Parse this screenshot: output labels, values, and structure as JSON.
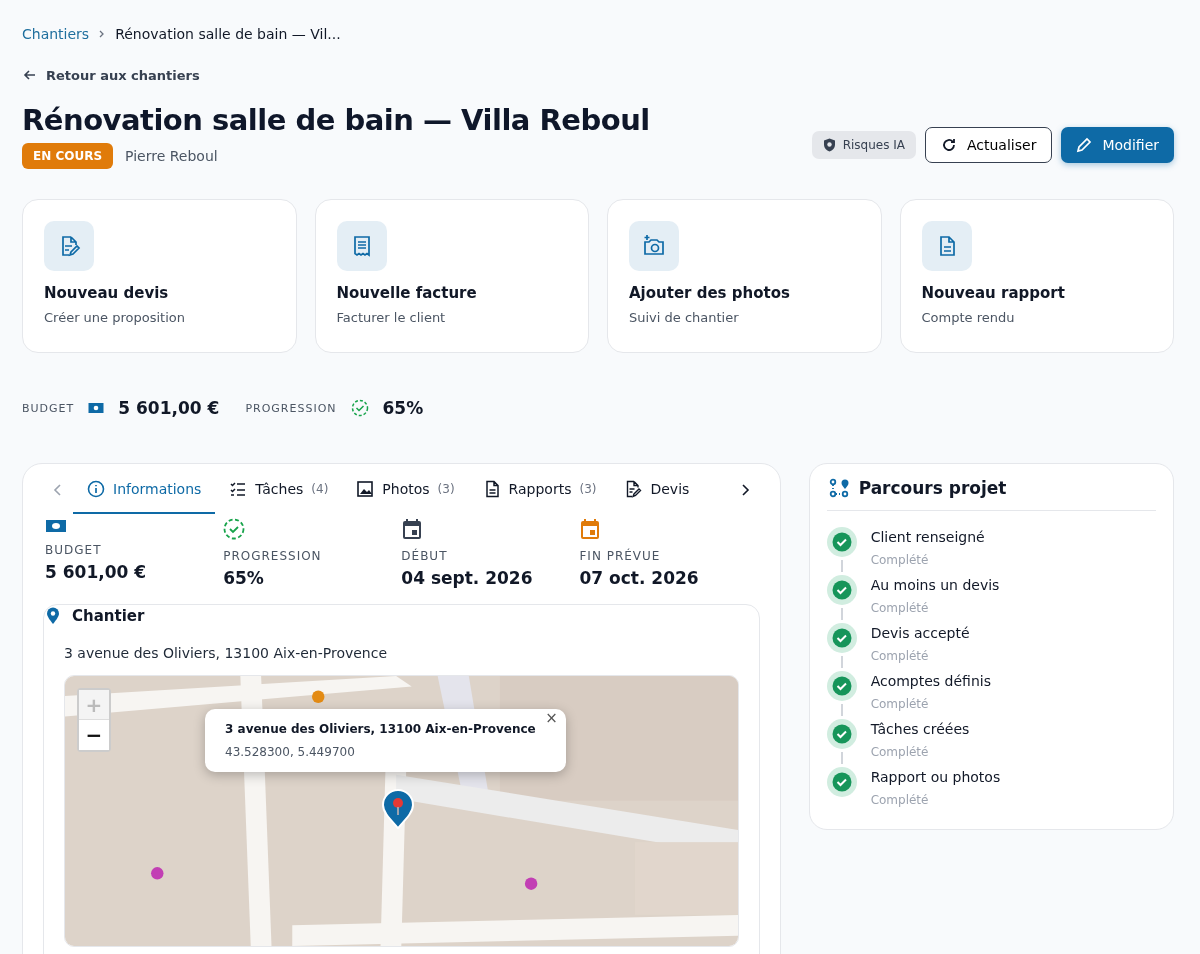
{
  "breadcrumb": {
    "link": "Chantiers",
    "current": "Rénovation salle de bain — Vil..."
  },
  "back_link": "Retour aux chantiers",
  "title": "Rénovation salle de bain — Villa Reboul",
  "status": {
    "label": "EN COURS",
    "color": "#e07b0a"
  },
  "client": "Pierre Reboul",
  "actions": [
    {
      "label": "Risques IA",
      "kind": "chip"
    },
    {
      "label": "Actualiser",
      "kind": "outline"
    },
    {
      "label": "Modifier",
      "kind": "primary"
    }
  ],
  "quick_actions": [
    {
      "title": "Nouveau devis",
      "subtitle": "Créer une proposition",
      "kind": "quote"
    },
    {
      "title": "Nouvelle facture",
      "subtitle": "Facturer le client",
      "kind": "invoice"
    },
    {
      "title": "Ajouter des photos",
      "subtitle": "Suivi de chantier"
    },
    {
      "title": "Nouveau rapport",
      "subtitle": "Compte rendu",
      "kind": "report"
    }
  ],
  "summary": [
    {
      "label": "BUDGET",
      "value": "5 601,00 €",
      "kind": "money"
    },
    {
      "label": "PROGRESSION",
      "value": "65%",
      "kind": "progress"
    }
  ],
  "tabs": [
    {
      "label": "Informations",
      "kind": "info",
      "selected": true
    },
    {
      "label": "Tâches",
      "count": "(4)",
      "kind": "tasks",
      "selected": false
    },
    {
      "label": "Photos",
      "count": "(3)",
      "kind": "photos",
      "selected": false
    },
    {
      "label": "Rapports",
      "count": "(3)",
      "kind": "reports",
      "selected": false
    },
    {
      "label": "Devis",
      "kind": "quote",
      "selected": false
    }
  ],
  "stats": [
    {
      "label": "BUDGET",
      "value": "5 601,00 €",
      "kind": "money"
    },
    {
      "label": "PROGRESSION",
      "value": "65%",
      "kind": "progress"
    },
    {
      "label": "DÉBUT",
      "value": "04 sept. 2026",
      "kind": "start"
    },
    {
      "label": "FIN PRÉVUE",
      "value": "07 oct. 2026",
      "kind": "end"
    }
  ],
  "site": {
    "title": "Chantier",
    "address": "3 avenue des Oliviers, 13100 Aix-en-Provence",
    "map": {
      "zoom_in": {
        "label": "+",
        "disabled": true
      },
      "zoom_out": {
        "label": "−",
        "disabled": false
      },
      "popup": {
        "title": "3 avenue des Oliviers, 13100 Aix-en-Provence",
        "coords": "43.528300, 5.449700",
        "close": "×"
      }
    }
  },
  "journey": {
    "title": "Parcours projet",
    "steps": [
      {
        "label": "Client renseigné",
        "status": "Complété",
        "done": true
      },
      {
        "label": "Au moins un devis",
        "status": "Complété",
        "done": true
      },
      {
        "label": "Devis accepté",
        "status": "Complété",
        "done": true
      },
      {
        "label": "Acomptes définis",
        "status": "Complété",
        "done": true
      },
      {
        "label": "Tâches créées",
        "status": "Complété",
        "done": true
      },
      {
        "label": "Rapport ou photos",
        "status": "Complété",
        "done": true
      }
    ]
  }
}
